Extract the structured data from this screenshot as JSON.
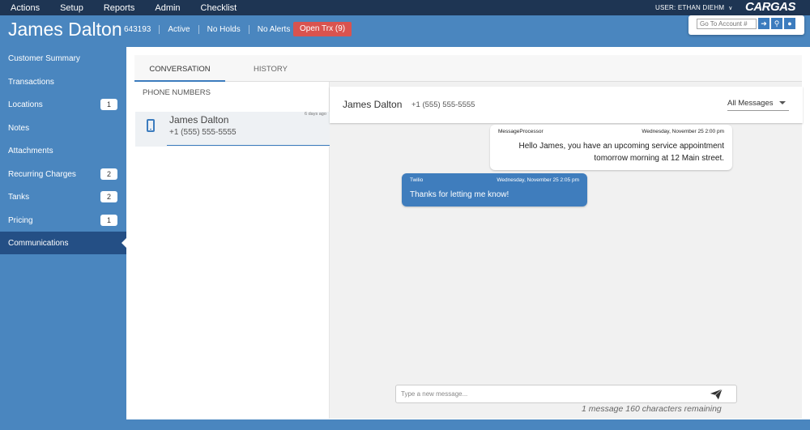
{
  "menu": [
    "Actions",
    "Setup",
    "Reports",
    "Admin",
    "Checklist"
  ],
  "user": {
    "label": "USER: ETHAN DIEHM"
  },
  "logo": "CARGAS",
  "account": {
    "name": "James Dalton",
    "number": "643193",
    "status": "Active",
    "holds": "No Holds",
    "alerts": "No Alerts",
    "open_trx": "Open Trx (9)"
  },
  "goto": {
    "placeholder": "Go To Account #"
  },
  "sidebar": {
    "items": [
      {
        "label": "Customer Summary",
        "badge": ""
      },
      {
        "label": "Transactions",
        "badge": ""
      },
      {
        "label": "Locations",
        "badge": "1"
      },
      {
        "label": "Notes",
        "badge": ""
      },
      {
        "label": "Attachments",
        "badge": ""
      },
      {
        "label": "Recurring Charges",
        "badge": "2"
      },
      {
        "label": "Tanks",
        "badge": "2"
      },
      {
        "label": "Pricing",
        "badge": "1"
      },
      {
        "label": "Communications",
        "badge": ""
      }
    ]
  },
  "tabs": [
    "CONVERSATION",
    "HISTORY"
  ],
  "phone": {
    "header": "PHONE NUMBERS",
    "entry": {
      "name": "James Dalton",
      "number": "+1 (555) 555-5555",
      "ago": "6 days ago"
    }
  },
  "chat": {
    "name": "James Dalton",
    "number": "+1 (555) 555-5555",
    "filter": "All Messages",
    "messages": [
      {
        "from": "MessageProcessor",
        "time": "Wednesday, November 25 2:00 pm",
        "text": "Hello James, you have an upcoming service appointment tomorrow morning at 12 Main street."
      },
      {
        "from": "Twilio",
        "time": "Wednesday, November 25 2:05 pm",
        "text": "Thanks for letting me know!"
      }
    ],
    "compose_placeholder": "Type a new message...",
    "remaining": "1 message 160 characters remaining"
  },
  "colors": {
    "brand": "#4a86bf",
    "topbar": "#1e3553",
    "active_nav": "#244f85",
    "alert": "#d9534f",
    "bubble_out": "#3f7dbd"
  }
}
